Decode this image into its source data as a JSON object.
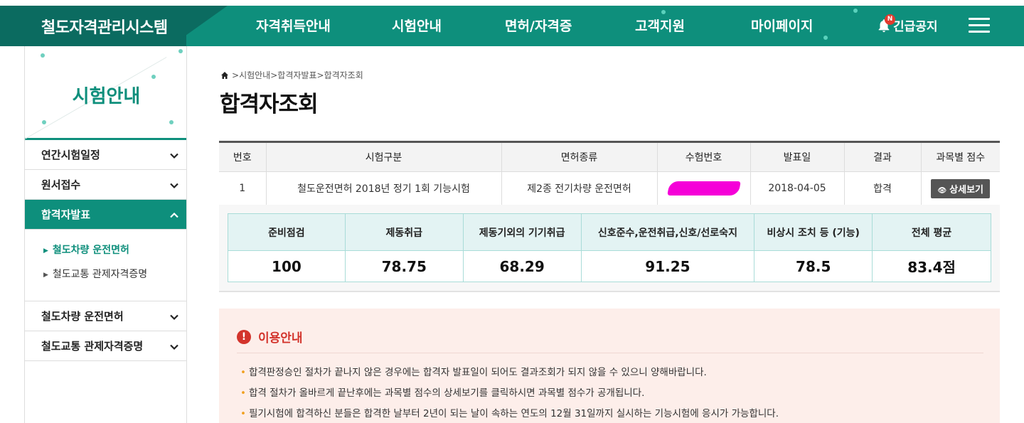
{
  "header": {
    "logo": "철도자격관리시스템",
    "nav": [
      "자격취득안내",
      "시험안내",
      "면허/자격증",
      "고객지원",
      "마이페이지"
    ],
    "alert_label": "긴급공지",
    "alert_badge": "N",
    "menu_icon": "hamburger-icon",
    "bell_icon": "bell-icon",
    "colors": {
      "primary": "#0e8f7c",
      "dark": "#0b6b60"
    }
  },
  "sidebar": {
    "title": "시험안내",
    "items": [
      {
        "label": "연간시험일정",
        "state": "collapsed"
      },
      {
        "label": "원서접수",
        "state": "collapsed"
      },
      {
        "label": "합격자발표",
        "state": "expanded"
      },
      {
        "label": "철도차량 운전면허",
        "state": "collapsed"
      },
      {
        "label": "철도교통 관제자격증명",
        "state": "collapsed"
      }
    ],
    "subitems": [
      "철도차량 운전면허",
      "철도교통 관제자격증명"
    ]
  },
  "breadcrumb": {
    "parts": [
      "시험안내",
      "합격자발표",
      "합격자조회"
    ],
    "sep": ">"
  },
  "page_title": "합격자조회",
  "result_table": {
    "headers": [
      "번호",
      "시험구분",
      "면허종류",
      "수험번호",
      "발표일",
      "결과",
      "과목별 점수"
    ],
    "row": {
      "no": "1",
      "exam": "철도운전면허 2018년 정기 1회 기능시험",
      "license": "제2종 전기차량 운전면허",
      "exam_number": "",
      "date": "2018-04-05",
      "result": "합격",
      "detail_button": "상세보기"
    }
  },
  "scores": {
    "headers": [
      "준비점검",
      "제동취급",
      "제동기외의 기기취급",
      "신호준수,운전취급,신호/선로숙지",
      "비상시 조치 등 (기능)",
      "전체 평균"
    ],
    "values": [
      "100",
      "78.75",
      "68.29",
      "91.25",
      "78.5",
      "83.4점"
    ]
  },
  "notice": {
    "title": "이용안내",
    "items": [
      "합격판정승인 절차가 끝나지 않은 경우에는 합격자 발표일이 되어도 결과조회가 되지 않을 수 있으니 양해바랍니다.",
      "합격 절차가 올바르게 끝난후에는 과목별 점수의 상세보기를 클릭하시면 과목별 점수가 공개됩니다.",
      "필기시험에 합격하신 분들은 합격한 날부터 2년이 되는 날이 속하는 연도의 12월 31일까지 실시하는 기능시험에 응시가 가능합니다."
    ]
  }
}
